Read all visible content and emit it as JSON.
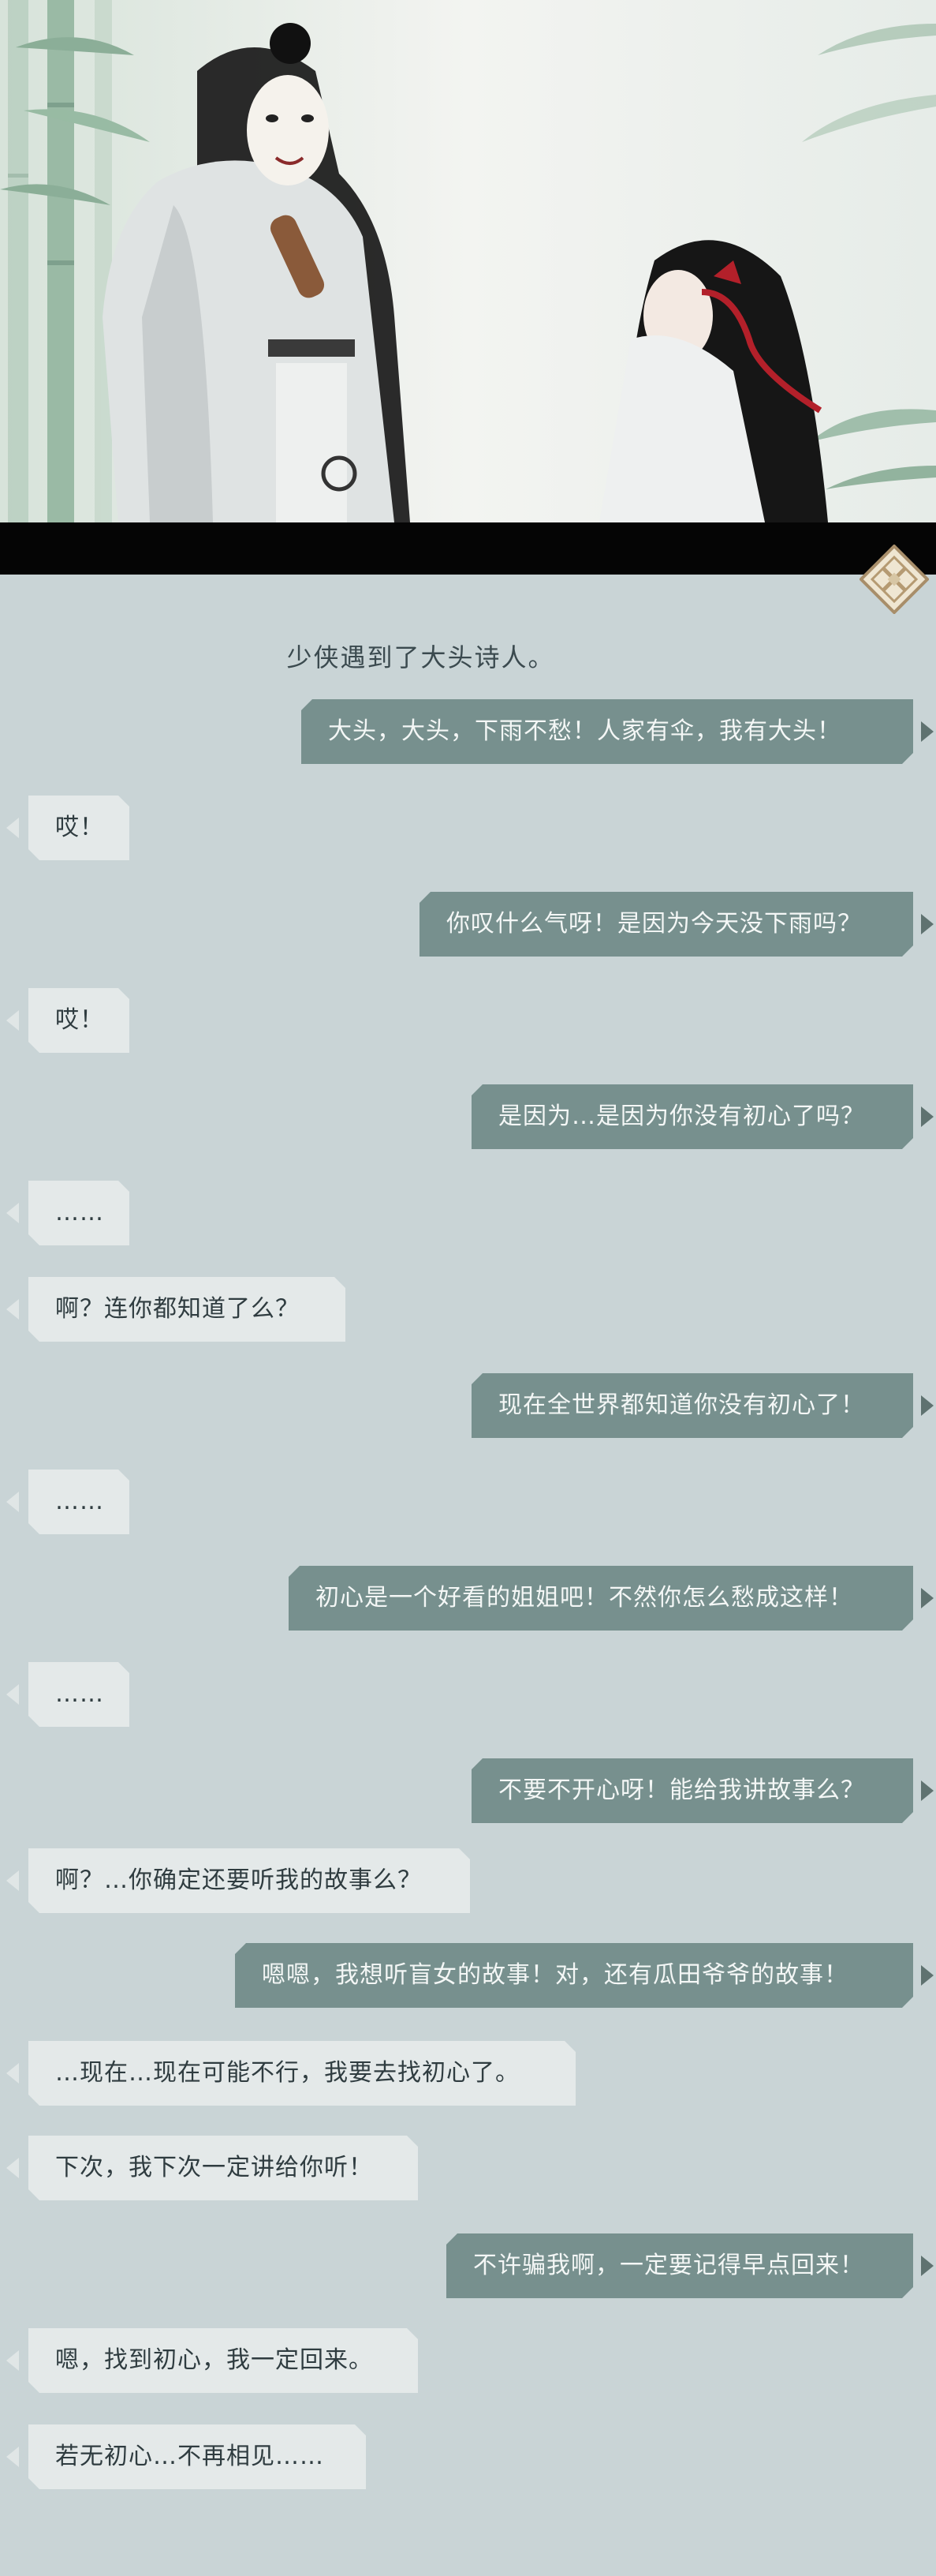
{
  "narration": "少侠遇到了大头诗人。",
  "messages": [
    {
      "side": "right",
      "text": "大头，大头，下雨不愁！人家有伞，我有大头！"
    },
    {
      "side": "left",
      "text": "哎！"
    },
    {
      "side": "right",
      "text": "你叹什么气呀！是因为今天没下雨吗？"
    },
    {
      "side": "left",
      "text": "哎！"
    },
    {
      "side": "right",
      "text": "是因为…是因为你没有初心了吗？"
    },
    {
      "side": "left",
      "text": "……"
    },
    {
      "side": "left",
      "text": "啊？连你都知道了么？"
    },
    {
      "side": "right",
      "text": "现在全世界都知道你没有初心了！"
    },
    {
      "side": "left",
      "text": "……"
    },
    {
      "side": "right",
      "text": "初心是一个好看的姐姐吧！不然你怎么愁成这样！"
    },
    {
      "side": "left",
      "text": "……"
    },
    {
      "side": "right",
      "text": "不要不开心呀！能给我讲故事么？"
    },
    {
      "side": "left",
      "text": "啊？…你确定还要听我的故事么？"
    },
    {
      "side": "right",
      "text": "嗯嗯，我想听盲女的故事！对，还有瓜田爷爷的故事！"
    },
    {
      "side": "left",
      "text": "…现在…现在可能不行，我要去找初心了。"
    },
    {
      "side": "left",
      "text": "下次，我下次一定讲给你听！"
    },
    {
      "side": "right",
      "text": "不许骗我啊，一定要记得早点回来！"
    },
    {
      "side": "left",
      "text": "嗯，找到初心，我一定回来。"
    },
    {
      "side": "left",
      "text": "若无初心…不再相见……"
    }
  ],
  "icons": {
    "menu": "diamond-lattice-icon",
    "next_right": "triangle-right-icon",
    "next_left": "triangle-left-icon"
  },
  "colors": {
    "background": "#c9d4d6",
    "player_bubble": "#77908e",
    "npc_bubble": "#e4e9e9",
    "band": "#050505"
  }
}
